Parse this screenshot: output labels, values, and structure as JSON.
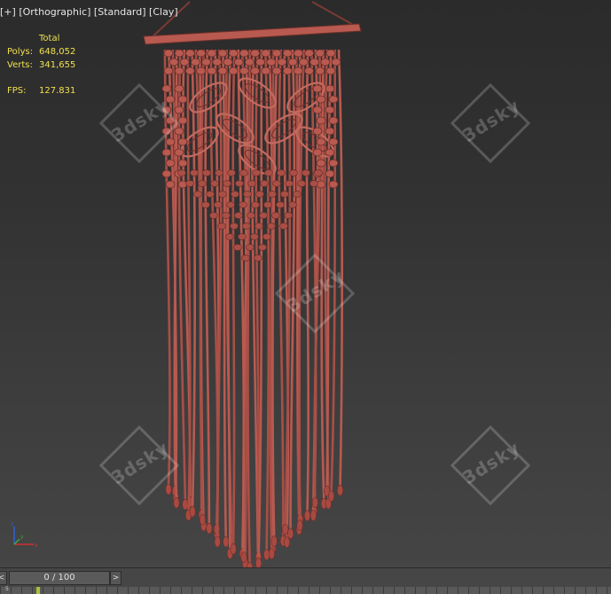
{
  "viewport": {
    "label": {
      "plus": "[+]",
      "view": "[Orthographic]",
      "shading_mode": "[Standard]",
      "style": "[Clay]"
    },
    "stats": {
      "header": "Total",
      "polys_label": "Polys:",
      "polys_value": "648,052",
      "verts_label": "Verts:",
      "verts_value": "341,655",
      "fps_label": "FPS:",
      "fps_value": "127.831"
    },
    "watermarks": [
      "3dsky",
      "3dsky",
      "3dsky",
      "3dsky",
      "3dsky"
    ],
    "axis": {
      "x": "x",
      "y": "y",
      "z": "z"
    },
    "colors": {
      "background_top": "#2b2b2b",
      "background_bottom": "#454545",
      "clay": "#b85a50",
      "stats_text": "#f0e050"
    }
  },
  "timeline": {
    "prev_label": "<",
    "frame_display": "0 / 100",
    "next_label": ">",
    "track_label": "5",
    "current_frame": 0,
    "total_frames": 100
  }
}
